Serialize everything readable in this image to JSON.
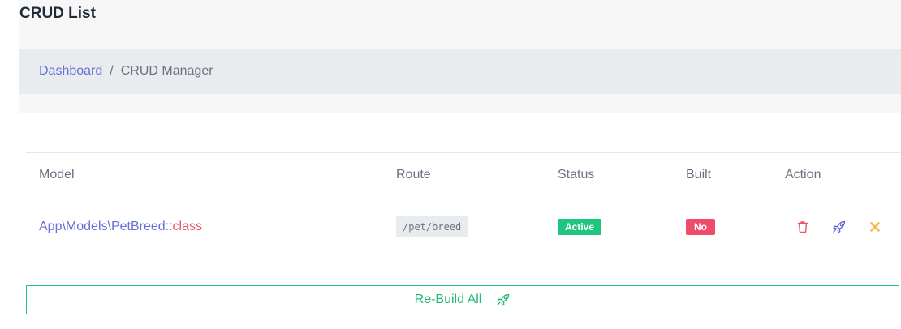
{
  "page": {
    "title": "CRUD List"
  },
  "breadcrumb": {
    "link": "Dashboard",
    "separator": "/",
    "current": "CRUD Manager"
  },
  "table": {
    "headers": {
      "model": "Model",
      "route": "Route",
      "status": "Status",
      "built": "Built",
      "action": "Action"
    },
    "rows": [
      {
        "model_path": "App\\Models\\PetBreed",
        "model_sep": "::",
        "model_class": "class",
        "route": "/pet/breed",
        "status": "Active",
        "built": "No",
        "actions": [
          "trash-icon",
          "rocket-icon",
          "close-icon"
        ]
      }
    ]
  },
  "rebuild": {
    "label": "Re-Build All",
    "icon": "rocket-icon"
  },
  "colors": {
    "link": "#6571d6",
    "success": "#20c680",
    "danger": "#ef4c6b",
    "warning": "#f6b94a"
  }
}
